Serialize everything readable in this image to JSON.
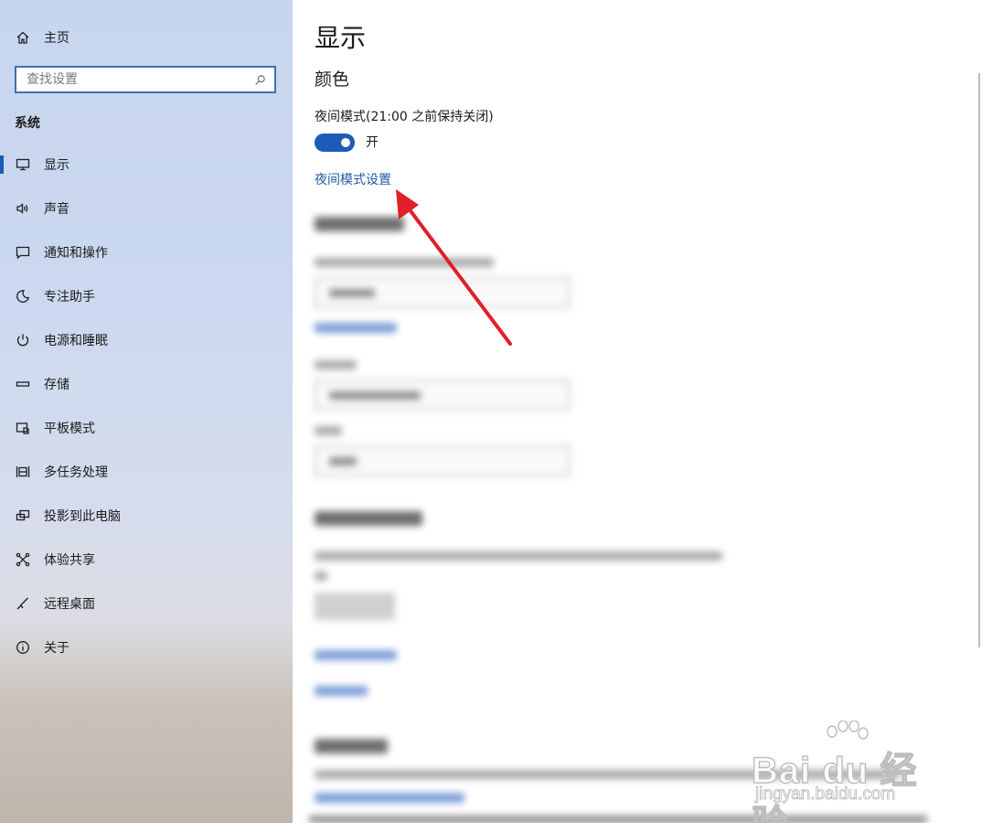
{
  "sidebar": {
    "home_label": "主页",
    "search_placeholder": "查找设置",
    "section_title": "系统",
    "items": [
      {
        "label": "显示",
        "icon": "monitor-icon",
        "active": true
      },
      {
        "label": "声音",
        "icon": "speaker-icon"
      },
      {
        "label": "通知和操作",
        "icon": "notification-icon"
      },
      {
        "label": "专注助手",
        "icon": "moon-icon"
      },
      {
        "label": "电源和睡眠",
        "icon": "power-icon"
      },
      {
        "label": "存储",
        "icon": "storage-icon"
      },
      {
        "label": "平板模式",
        "icon": "tablet-icon"
      },
      {
        "label": "多任务处理",
        "icon": "multitask-icon"
      },
      {
        "label": "投影到此电脑",
        "icon": "project-icon"
      },
      {
        "label": "体验共享",
        "icon": "share-icon"
      },
      {
        "label": "远程桌面",
        "icon": "remote-icon"
      },
      {
        "label": "关于",
        "icon": "info-icon"
      }
    ]
  },
  "main": {
    "title": "显示",
    "color_heading": "颜色",
    "night_mode_label": "夜间模式(21:00 之前保持关闭)",
    "toggle_state": "开",
    "toggle_on": true,
    "night_mode_settings_link": "夜间模式设置"
  },
  "colors": {
    "accent": "#1e5bb8",
    "link": "#1f5aa6",
    "annotation_arrow": "#e0202a"
  },
  "watermark": {
    "brand": "Bai du 经验",
    "url": "jingyan.baidu.com"
  }
}
